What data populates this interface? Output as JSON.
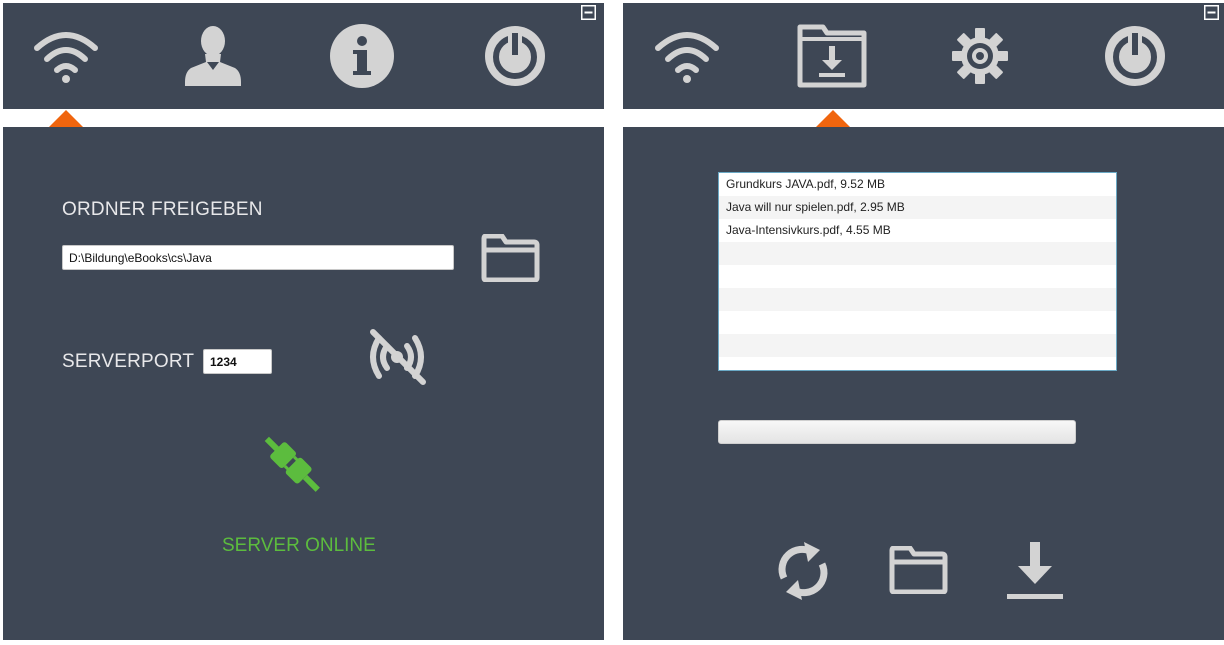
{
  "colors": {
    "panel_bg": "#3e4755",
    "icon": "#d3d3d3",
    "accent_caret": "#f0650e",
    "online_green": "#5cbc3e"
  },
  "server_panel": {
    "nav": [
      "wifi-icon",
      "user-icon",
      "info-icon",
      "power-icon"
    ],
    "active_nav": "wifi-icon",
    "share_folder_label": "ORDNER FREIGEBEN",
    "folder_path": "D:\\Bildung\\eBooks\\cs\\Java",
    "serverport_label": "SERVERPORT",
    "serverport_value": "1234",
    "status_text": "SERVER ONLINE"
  },
  "client_panel": {
    "nav": [
      "wifi-icon",
      "download-folder-icon",
      "gear-icon",
      "power-icon"
    ],
    "active_nav": "download-folder-icon",
    "files": [
      "Grundkurs JAVA.pdf, 9.52 MB",
      "Java will nur spielen.pdf, 2.95 MB",
      "Java-Intensivkurs.pdf, 4.55 MB",
      "",
      "",
      "",
      "",
      "",
      ""
    ],
    "download_progress": 0,
    "actions": [
      "refresh-icon",
      "folder-icon",
      "download-icon"
    ]
  }
}
